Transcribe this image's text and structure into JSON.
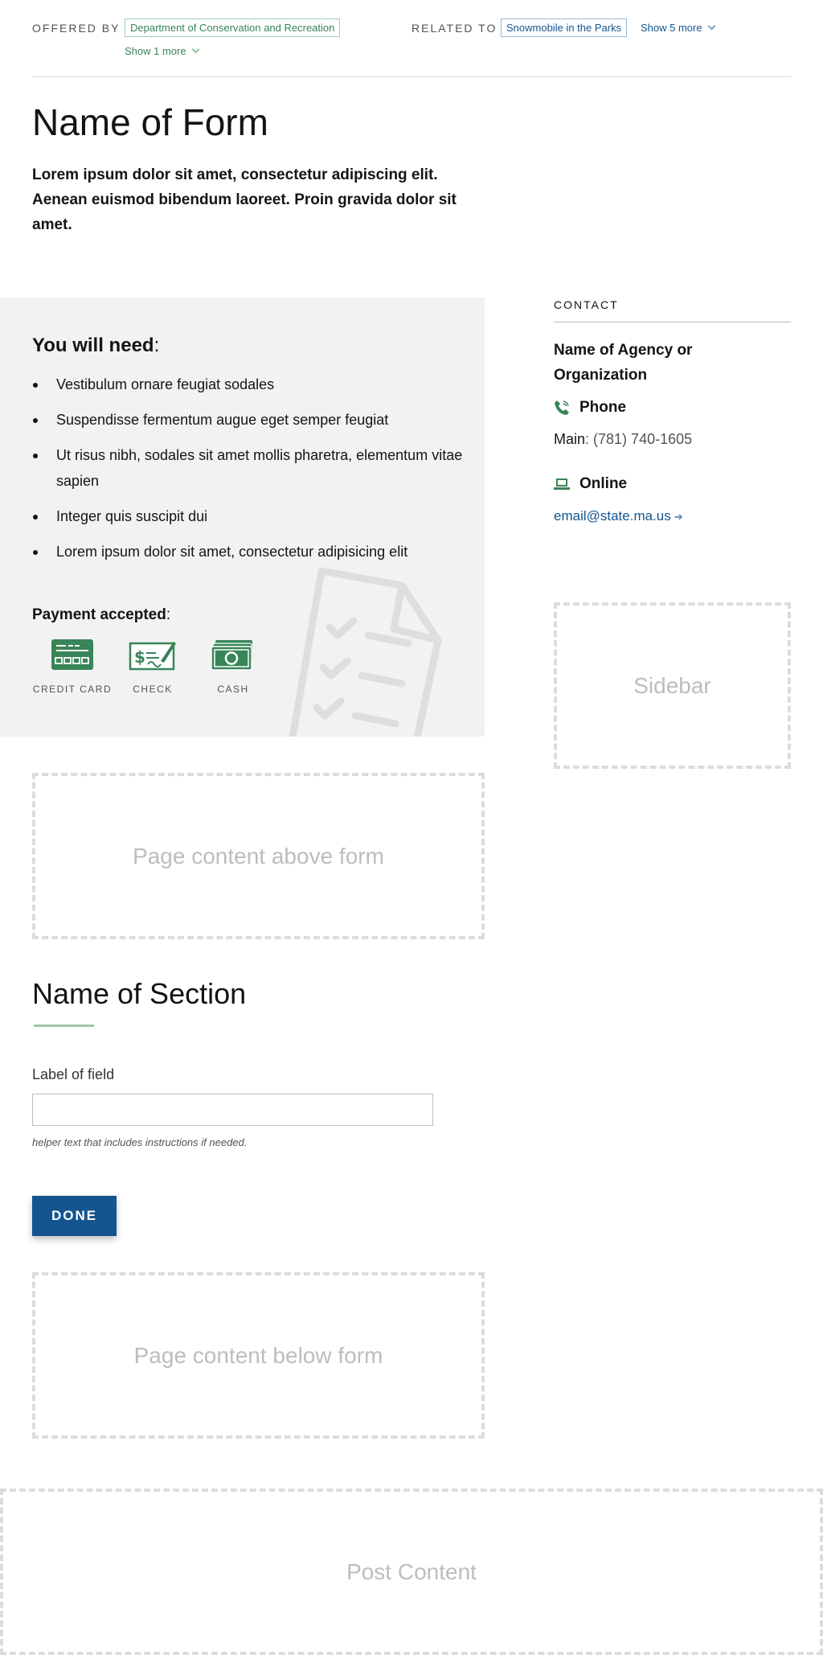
{
  "meta": {
    "offered_by_label": "OFFERED BY",
    "offered_by_tag": "Department of Conservation and Recreation",
    "offered_by_more": "Show 1 more",
    "related_to_label": "RELATED TO",
    "related_to_tag": "Snowmobile in the Parks",
    "related_to_more": "Show 5 more"
  },
  "page": {
    "title": "Name of Form",
    "lede": "Lorem ipsum dolor sit amet, consectetur adipiscing elit. Aenean euismod bibendum laoreet. Proin gravida dolor sit amet."
  },
  "need": {
    "heading": "You will need",
    "heading_suffix": ":",
    "items": [
      "Vestibulum ornare feugiat sodales",
      "Suspendisse fermentum augue eget semper feugiat",
      "Ut risus nibh, sodales sit amet mollis pharetra, elementum vitae sapien",
      "Integer quis suscipit dui",
      "Lorem ipsum dolor sit amet, consectetur adipisicing elit"
    ],
    "payment_heading": "Payment accepted",
    "payment_suffix": ":",
    "payments": [
      {
        "label": "CREDIT CARD",
        "icon": "credit-card-icon"
      },
      {
        "label": "CHECK",
        "icon": "check-icon"
      },
      {
        "label": "CASH",
        "icon": "cash-icon"
      }
    ]
  },
  "contact": {
    "label": "CONTACT",
    "agency": "Name of Agency or Organization",
    "phone_heading": "Phone",
    "phone_prefix": "Main",
    "phone_sep": ": ",
    "phone_number": "(781) 740-1605",
    "online_heading": "Online",
    "email": "email@state.ma.us",
    "email_arrow": "➔"
  },
  "placeholders": {
    "sidebar": "Sidebar",
    "above_form": "Page content above form",
    "below_form": "Page content below form",
    "post": "Post Content"
  },
  "form": {
    "section_title": "Name of Section",
    "field_label": "Label of field",
    "field_value": "",
    "helper_text": "helper text that includes instructions if needed.",
    "done_label": "DONE"
  },
  "colors": {
    "green": "#388557",
    "blue": "#14558f",
    "grey_bg": "#f2f2f2"
  }
}
